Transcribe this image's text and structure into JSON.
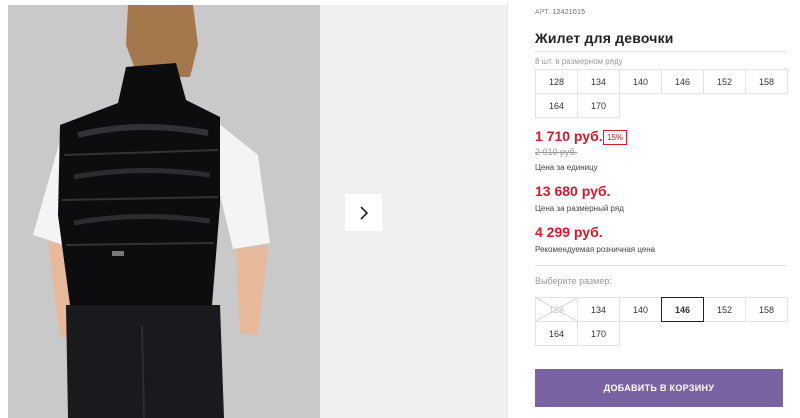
{
  "product": {
    "article_label": "АРТ.",
    "article": "12421015",
    "title": "Жилет для девочки"
  },
  "size_range": {
    "caption": "8 шт. в размерном ряду",
    "sizes": [
      "128",
      "134",
      "140",
      "146",
      "152",
      "158",
      "164",
      "170"
    ]
  },
  "prices": {
    "unit_price": "1 710 руб.",
    "discount": "15%",
    "old_price": "2 010 руб.",
    "unit_caption": "Цена за единицу",
    "range_price": "13 680 руб.",
    "range_caption": "Цена за размерный ряд",
    "retail_price": "4 299 руб.",
    "retail_caption": "Рекомендуемая розничная цена"
  },
  "size_select": {
    "caption": "Выберите размер:",
    "sizes": [
      "128",
      "134",
      "140",
      "146",
      "152",
      "158",
      "164",
      "170"
    ],
    "selected": "146",
    "unavailable": [
      "128"
    ]
  },
  "cta": {
    "label": "ДОБАВИТЬ В КОРЗИНУ"
  },
  "icons": {
    "next": "chevron-right-icon"
  },
  "colors": {
    "accent": "#7b62a3",
    "price": "#d9182a",
    "photo_bg": "#c9c9c9"
  }
}
